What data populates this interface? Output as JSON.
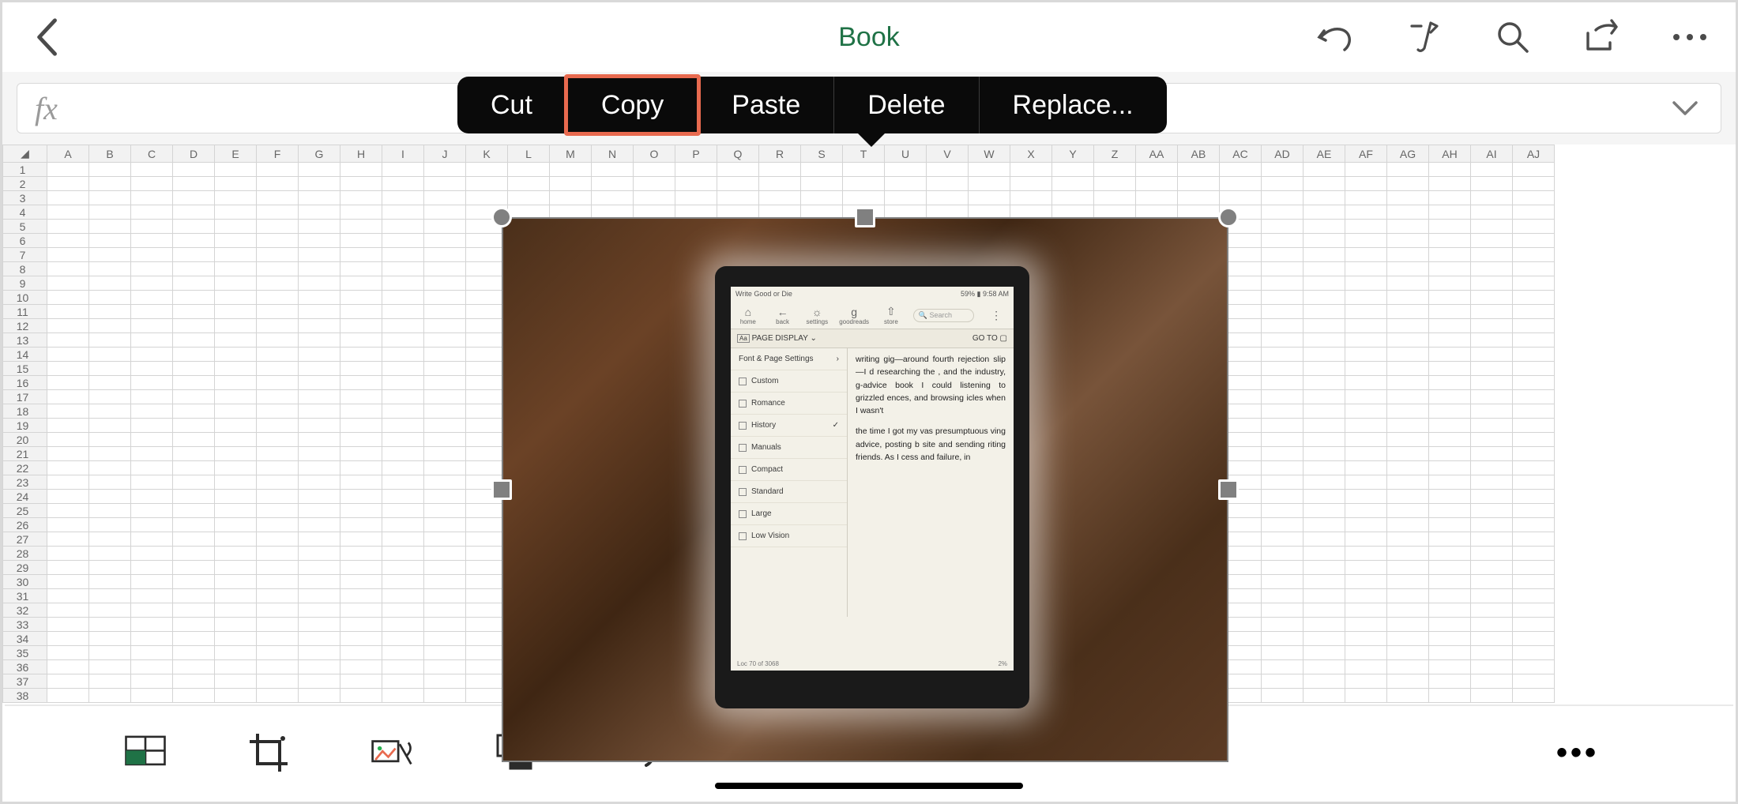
{
  "header": {
    "title": "Book"
  },
  "context_menu": {
    "items": [
      "Cut",
      "Copy",
      "Paste",
      "Delete",
      "Replace..."
    ],
    "highlighted_index": 1
  },
  "formula_bar": {
    "label": "fx",
    "value": ""
  },
  "sheet": {
    "columns": [
      "A",
      "B",
      "C",
      "D",
      "E",
      "F",
      "G",
      "H",
      "I",
      "J",
      "K",
      "L",
      "M",
      "N",
      "O",
      "P",
      "Q",
      "R",
      "S",
      "T",
      "U",
      "V",
      "W",
      "X",
      "Y",
      "Z",
      "AA",
      "AB",
      "AC",
      "AD",
      "AE",
      "AF",
      "AG",
      "AH",
      "AI",
      "AJ"
    ],
    "row_count": 38
  },
  "embedded_image": {
    "kindle": {
      "status_title": "Write Good or Die",
      "status_right": "59% ▮  9:58 AM",
      "toolbar": {
        "home": "home",
        "back": "back",
        "settings": "settings",
        "goodreads": "goodreads",
        "store": "store",
        "search_placeholder": "Search"
      },
      "pagedisplay_label": "PAGE DISPLAY",
      "goto_label": "GO TO",
      "sidebar": {
        "section": "Font & Page Settings",
        "items": [
          "Custom",
          "Romance",
          "History",
          "Manuals",
          "Compact",
          "Standard",
          "Large",
          "Low Vision"
        ],
        "selected_index": 2
      },
      "body_text": "writing gig—around fourth rejection slip—I d researching the , and the industry, g-advice book I could listening to grizzled ences, and browsing icles when I wasn't\n\nthe time I got my vas presumptuous ving advice, posting b site and sending riting friends. As I cess and failure, in",
      "footer_left": "Loc 70 of 3068",
      "footer_right": "2%"
    }
  },
  "top_icons": {
    "back": "back",
    "undo": "undo",
    "draw": "draw",
    "search": "search",
    "share": "share",
    "more": "more"
  },
  "bottom_icons": {
    "cells": "cells",
    "crop": "crop",
    "styles": "styles",
    "arrange": "arrange",
    "undo": "undo",
    "more": "more"
  }
}
